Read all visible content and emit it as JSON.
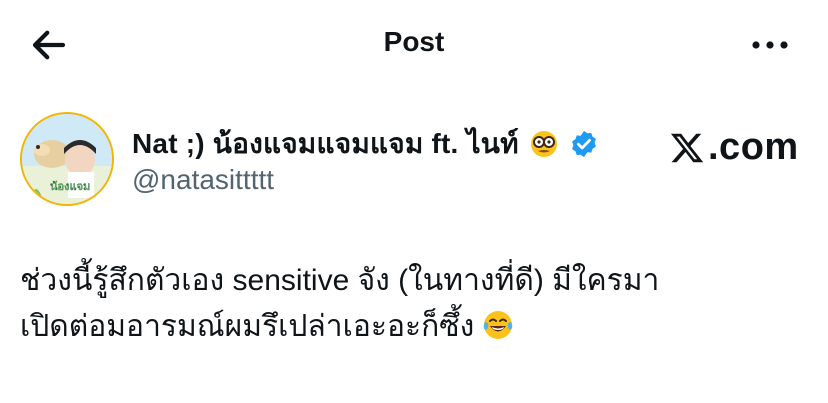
{
  "topbar": {
    "title": "Post"
  },
  "author": {
    "display_name": "Nat ;) น้องแจมแจมแจม ft. ไนท์",
    "handle": "@natasittttt",
    "avatar_badge_text": "น้องแจม"
  },
  "brand": {
    "text": ".com"
  },
  "tweet": {
    "line1": "ช่วงนี้รู้สึกตัวเอง sensitive จัง (ในทางที่ดี) มีใครมา",
    "line2": "เปิดต่อมอารมณ์ผมรึเปล่าเอะอะก็ซึ้ง"
  },
  "icons": {
    "back": "arrow-left-icon",
    "more": "more-horizontal-icon",
    "verified": "verified-badge-icon",
    "emoji_face": "nerd-glasses-emoji-icon",
    "emoji_laugh": "tears-of-joy-emoji-icon",
    "x_logo": "x-logo-icon"
  },
  "colors": {
    "verified": "#1d9bf0",
    "handle": "#536471",
    "text": "#0f1419",
    "avatar_ring": "#f4b400"
  }
}
